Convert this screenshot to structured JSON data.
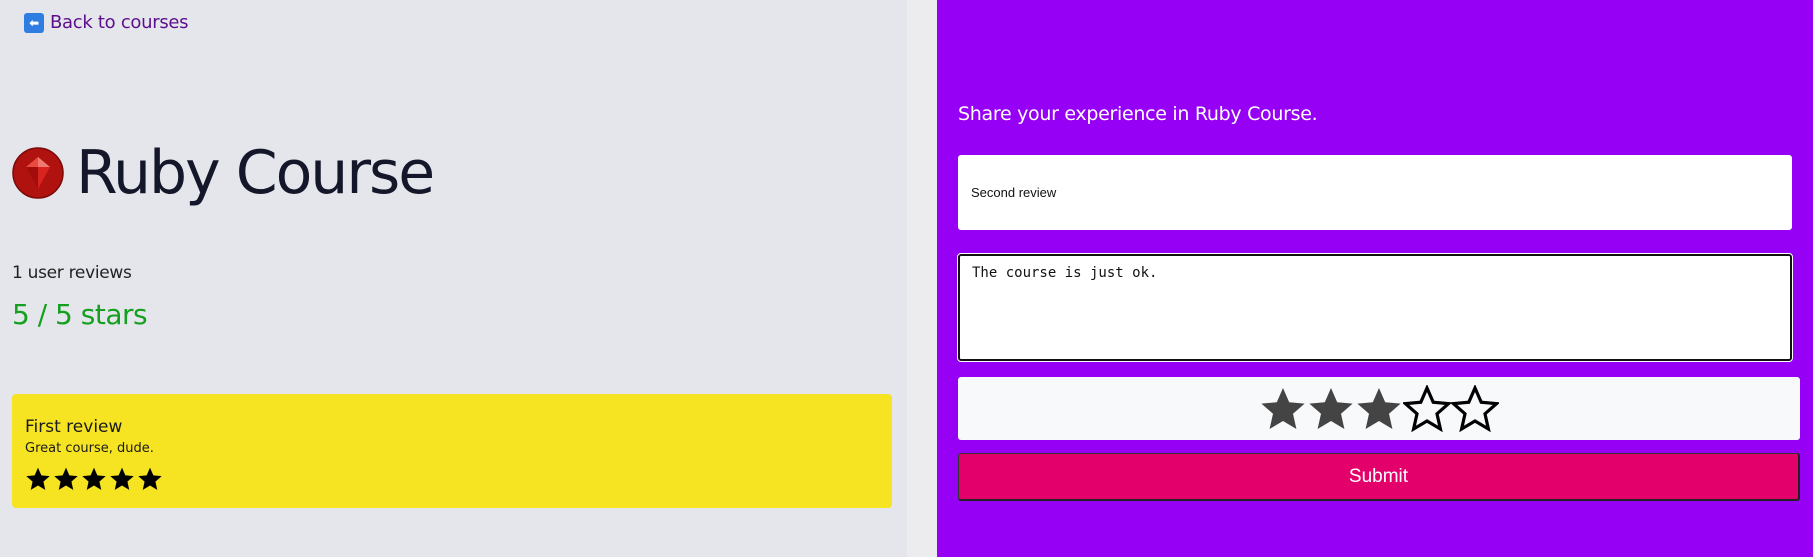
{
  "nav": {
    "back_label": "Back to courses",
    "back_icon": "back-arrow-icon"
  },
  "course": {
    "title": "Ruby Course",
    "icon": "ruby-gem-icon",
    "review_count_text": "1 user reviews",
    "average_text": "5 / 5 stars"
  },
  "reviews": [
    {
      "title": "First review",
      "body": "Great course, dude.",
      "rating": 5,
      "max_rating": 5
    }
  ],
  "form": {
    "prompt": "Share your experience in Ruby Course.",
    "title_value": "Second review",
    "body_value": "The course is just ok.",
    "rating": 3,
    "max_rating": 5,
    "submit_label": "Submit"
  },
  "colors": {
    "left_bg": "#e5e6ec",
    "right_bg": "#9600f5",
    "review_card_bg": "#f6e322",
    "average_green": "#14a01e",
    "submit_bg": "#e4006b",
    "link_purple": "#5b0e8c"
  }
}
